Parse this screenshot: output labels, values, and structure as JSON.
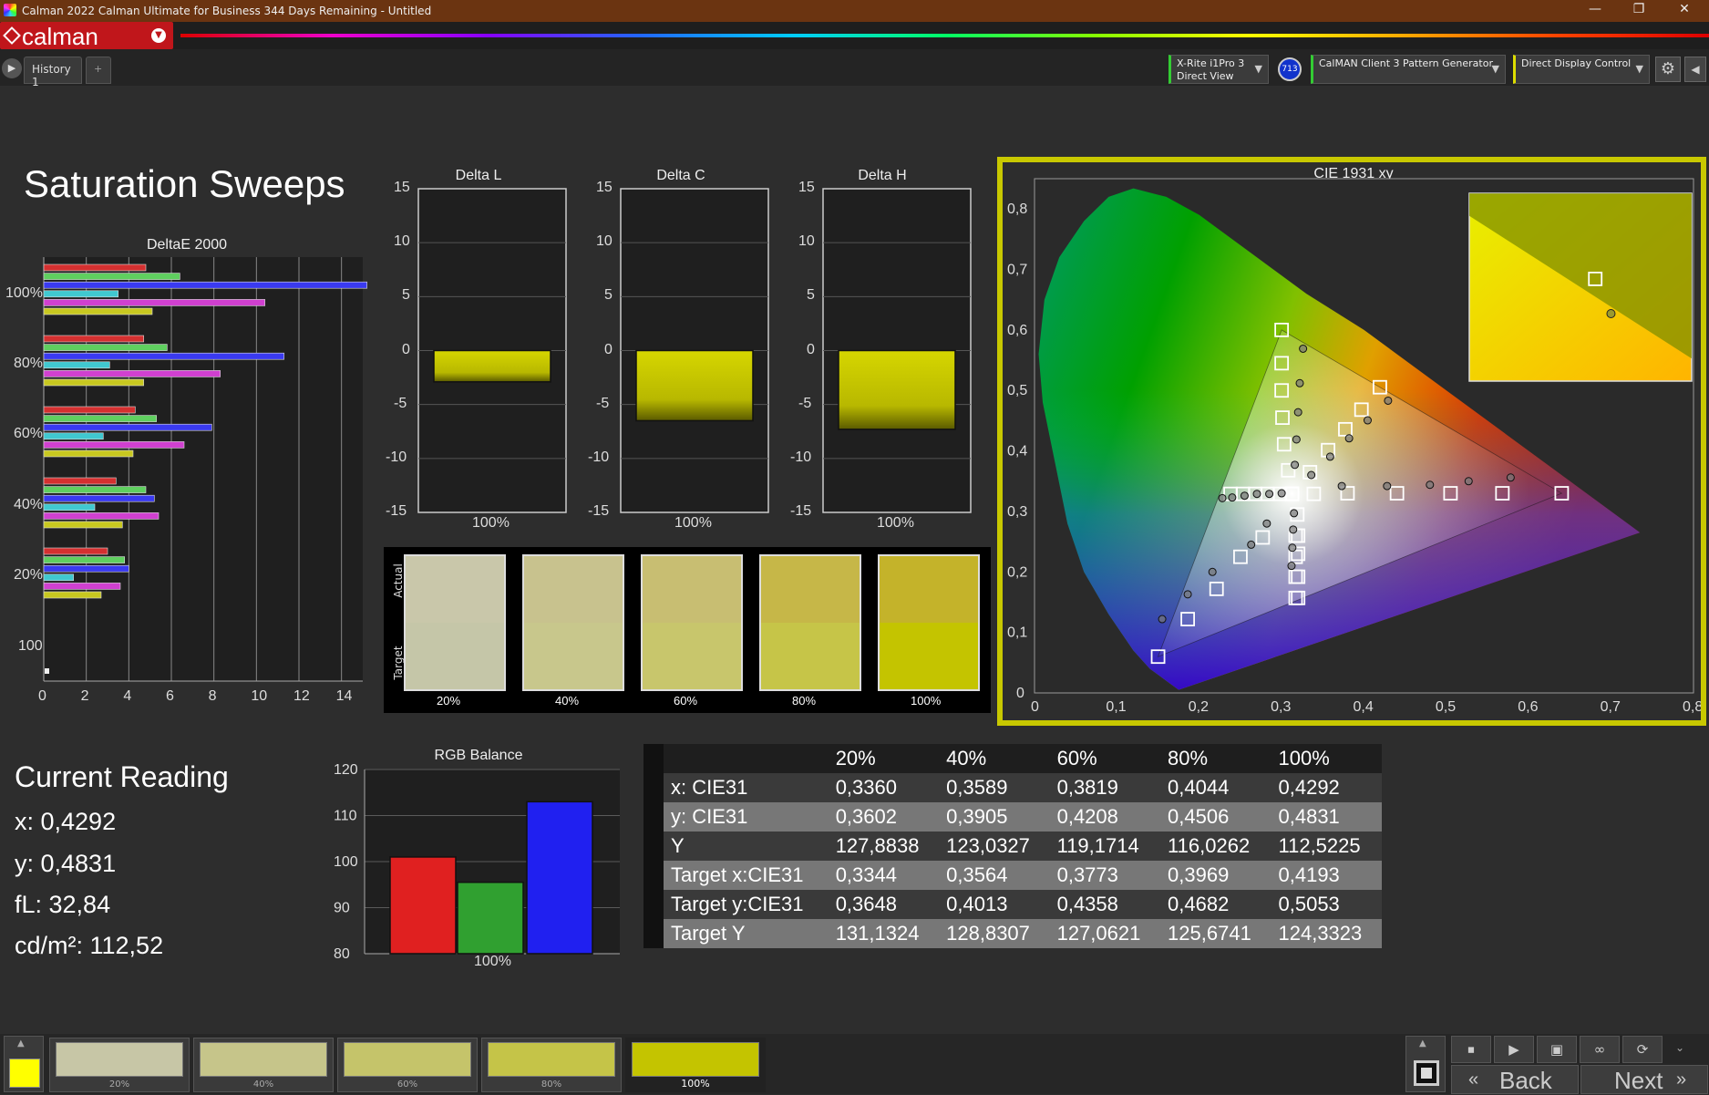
{
  "window": {
    "title": "Calman 2022 Calman Ultimate for Business 344 Days Remaining  - Untitled",
    "minimize": "—",
    "maximize": "❐",
    "close": "✕"
  },
  "logo": {
    "text": "calman"
  },
  "tabs": [
    {
      "label": "History 1"
    },
    {
      "label": "+"
    }
  ],
  "devices": [
    {
      "line1": "X-Rite i1Pro 3",
      "line2": "Direct View",
      "badge": "713"
    },
    {
      "line1": "CalMAN Client 3 Pattern Generator",
      "line2": ""
    },
    {
      "line1": "Direct Display Control",
      "line2": ""
    }
  ],
  "page_title": "Saturation Sweeps",
  "current_reading": {
    "title": "Current Reading",
    "x": "x: 0,4292",
    "y": "y: 0,4831",
    "fL": "fL: 32,84",
    "cdm2": "cd/m²: 112,52"
  },
  "charts": {
    "deltae": {
      "title": "DeltaE 2000",
      "ylabels": [
        "100%",
        "80%",
        "60%",
        "40%",
        "20%",
        "100"
      ],
      "xticks": [
        "0",
        "2",
        "4",
        "6",
        "8",
        "10",
        "12",
        "14"
      ]
    },
    "delta_l": {
      "title": "Delta L",
      "yticks": [
        "15",
        "10",
        "5",
        "0",
        "-5",
        "-10",
        "-15"
      ],
      "xlabel": "100%"
    },
    "delta_c": {
      "title": "Delta C",
      "yticks": [
        "15",
        "10",
        "5",
        "0",
        "-5",
        "-10",
        "-15"
      ],
      "xlabel": "100%"
    },
    "delta_h": {
      "title": "Delta H",
      "yticks": [
        "15",
        "10",
        "5",
        "0",
        "-5",
        "-10",
        "-15"
      ],
      "xlabel": "100%"
    },
    "swatches": {
      "actual": "Actual",
      "target": "Target",
      "labels": [
        "20%",
        "40%",
        "60%",
        "80%",
        "100%"
      ]
    },
    "cie": {
      "title": "CIE 1931 xy",
      "xticks": [
        "0",
        "0,1",
        "0,2",
        "0,3",
        "0,4",
        "0,5",
        "0,6",
        "0,7",
        "0,8"
      ],
      "yticks": [
        "0",
        "0,1",
        "0,2",
        "0,3",
        "0,4",
        "0,5",
        "0,6",
        "0,7",
        "0,8"
      ]
    },
    "rgb": {
      "title": "RGB Balance",
      "yticks": [
        "120",
        "110",
        "100",
        "90",
        "80"
      ],
      "xlabel": "100%"
    }
  },
  "chart_data": [
    {
      "type": "bar",
      "title": "DeltaE 2000",
      "orientation": "horizontal",
      "groups": [
        "100%",
        "80%",
        "60%",
        "40%",
        "20%"
      ],
      "series": [
        {
          "color": "#d43030",
          "values": [
            4.8,
            4.7,
            4.3,
            3.4,
            3.0
          ]
        },
        {
          "color": "#5fcf5f",
          "values": [
            6.4,
            5.8,
            5.3,
            4.8,
            3.8
          ]
        },
        {
          "color": "#3a3af0",
          "values": [
            15.2,
            11.3,
            7.9,
            5.2,
            4.0
          ]
        },
        {
          "color": "#40c8d0",
          "values": [
            3.5,
            3.1,
            2.8,
            2.4,
            1.4
          ]
        },
        {
          "color": "#d040d0",
          "values": [
            10.4,
            8.3,
            6.6,
            5.4,
            3.6
          ]
        },
        {
          "color": "#c8c820",
          "values": [
            5.1,
            4.7,
            4.2,
            3.7,
            2.7
          ]
        }
      ],
      "xlim": [
        0,
        15
      ]
    },
    {
      "type": "bar",
      "title": "Delta L",
      "categories": [
        "100%"
      ],
      "values": [
        -2.9
      ],
      "ylim": [
        -15,
        15
      ]
    },
    {
      "type": "bar",
      "title": "Delta C",
      "categories": [
        "100%"
      ],
      "values": [
        -6.5
      ],
      "ylim": [
        -15,
        15
      ]
    },
    {
      "type": "bar",
      "title": "Delta H",
      "categories": [
        "100%"
      ],
      "values": [
        -7.3
      ],
      "ylim": [
        -15,
        15
      ]
    },
    {
      "type": "bar",
      "title": "RGB Balance",
      "categories": [
        "100%"
      ],
      "series": [
        {
          "color": "#e02020",
          "values": [
            101
          ]
        },
        {
          "color": "#30a030",
          "values": [
            95.5
          ]
        },
        {
          "color": "#2020f0",
          "values": [
            113
          ]
        }
      ],
      "ylim": [
        80,
        120
      ]
    },
    {
      "type": "scatter",
      "title": "CIE 1931 xy",
      "xlim": [
        0,
        0.8
      ],
      "ylim": [
        0,
        0.85
      ],
      "gamut": [
        [
          0.64,
          0.33
        ],
        [
          0.3,
          0.6
        ],
        [
          0.15,
          0.06
        ]
      ],
      "targets": [
        [
          0.3127,
          0.329
        ],
        [
          0.339,
          0.329
        ],
        [
          0.38,
          0.33
        ],
        [
          0.44,
          0.33
        ],
        [
          0.505,
          0.33
        ],
        [
          0.568,
          0.33
        ],
        [
          0.64,
          0.33
        ],
        [
          0.3127,
          0.329
        ],
        [
          0.308,
          0.368
        ],
        [
          0.303,
          0.411
        ],
        [
          0.301,
          0.455
        ],
        [
          0.3,
          0.5
        ],
        [
          0.3,
          0.545
        ],
        [
          0.3,
          0.6
        ],
        [
          0.3127,
          0.329
        ],
        [
          0.298,
          0.329
        ],
        [
          0.283,
          0.329
        ],
        [
          0.268,
          0.329
        ],
        [
          0.253,
          0.329
        ],
        [
          0.238,
          0.329
        ],
        [
          0.3127,
          0.329
        ],
        [
          0.277,
          0.257
        ],
        [
          0.25,
          0.225
        ],
        [
          0.221,
          0.172
        ],
        [
          0.186,
          0.122
        ],
        [
          0.15,
          0.06
        ],
        [
          0.3127,
          0.329
        ],
        [
          0.32,
          0.26
        ],
        [
          0.32,
          0.23
        ],
        [
          0.32,
          0.192
        ],
        [
          0.32,
          0.157
        ],
        [
          0.3344,
          0.3648
        ],
        [
          0.3564,
          0.4013
        ],
        [
          0.3773,
          0.4358
        ],
        [
          0.3969,
          0.4682
        ],
        [
          0.4193,
          0.5053
        ],
        [
          0.3127,
          0.329
        ],
        [
          0.319,
          0.295
        ],
        [
          0.317,
          0.26
        ],
        [
          0.317,
          0.225
        ],
        [
          0.317,
          0.192
        ],
        [
          0.317,
          0.157
        ]
      ],
      "measured": [
        [
          0.326,
          0.569
        ],
        [
          0.322,
          0.512
        ],
        [
          0.32,
          0.464
        ],
        [
          0.318,
          0.419
        ],
        [
          0.316,
          0.377
        ],
        [
          0.3,
          0.33
        ],
        [
          0.285,
          0.329
        ],
        [
          0.27,
          0.329
        ],
        [
          0.255,
          0.326
        ],
        [
          0.24,
          0.323
        ],
        [
          0.228,
          0.322
        ],
        [
          0.282,
          0.28
        ],
        [
          0.263,
          0.245
        ],
        [
          0.216,
          0.2
        ],
        [
          0.186,
          0.163
        ],
        [
          0.155,
          0.122
        ],
        [
          0.315,
          0.297
        ],
        [
          0.314,
          0.27
        ],
        [
          0.313,
          0.24
        ],
        [
          0.312,
          0.21
        ],
        [
          0.336,
          0.3602
        ],
        [
          0.3589,
          0.3905
        ],
        [
          0.3819,
          0.4208
        ],
        [
          0.4044,
          0.4506
        ],
        [
          0.4292,
          0.4831
        ],
        [
          0.373,
          0.342
        ],
        [
          0.428,
          0.342
        ],
        [
          0.48,
          0.344
        ],
        [
          0.527,
          0.35
        ],
        [
          0.578,
          0.356
        ]
      ],
      "inset_target": [
        0.4193,
        0.5053
      ],
      "inset_measured": [
        0.4292,
        0.4831
      ]
    },
    {
      "type": "table",
      "title": "readings",
      "columns": [
        "",
        "20%",
        "40%",
        "60%",
        "80%",
        "100%"
      ],
      "rows": [
        [
          "x: CIE31",
          "0,3360",
          "0,3589",
          "0,3819",
          "0,4044",
          "0,4292"
        ],
        [
          "y: CIE31",
          "0,3602",
          "0,3905",
          "0,4208",
          "0,4506",
          "0,4831"
        ],
        [
          "Y",
          "127,8838",
          "123,0327",
          "119,1714",
          "116,0262",
          "112,5225"
        ],
        [
          "Target x:CIE31",
          "0,3344",
          "0,3564",
          "0,3773",
          "0,3969",
          "0,4193"
        ],
        [
          "Target y:CIE31",
          "0,3648",
          "0,4013",
          "0,4358",
          "0,4682",
          "0,5053"
        ],
        [
          "Target Y",
          "131,1324",
          "128,8307",
          "127,0621",
          "125,6741",
          "124,3323"
        ]
      ]
    }
  ],
  "swatch_colors": {
    "actual": [
      "#c9c7aa",
      "#c8c28e",
      "#c8be72",
      "#c6b748",
      "#c4b32a"
    ],
    "target": [
      "#c5c6a8",
      "#c8c78c",
      "#c8c66c",
      "#c6c548",
      "#c4c400"
    ]
  },
  "bottom_swatches": [
    {
      "label": "",
      "color": "#ffff00"
    },
    {
      "label": "20%",
      "color": "#c7c6a6"
    },
    {
      "label": "40%",
      "color": "#c6c58a"
    },
    {
      "label": "60%",
      "color": "#c5c46a"
    },
    {
      "label": "80%",
      "color": "#c5c448"
    },
    {
      "label": "100%",
      "color": "#c4c400"
    }
  ],
  "nav": {
    "back": "Back",
    "next": "Next"
  }
}
